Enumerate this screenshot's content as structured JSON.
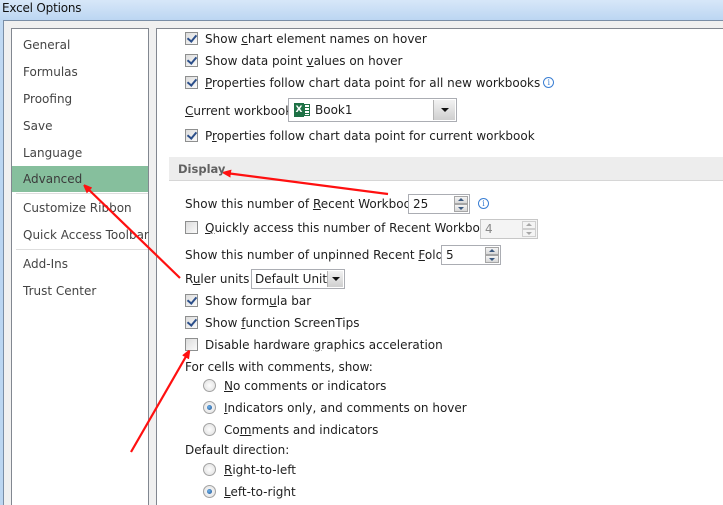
{
  "window": {
    "title": "Excel Options"
  },
  "sidebar": {
    "items": [
      {
        "label": "General"
      },
      {
        "label": "Formulas"
      },
      {
        "label": "Proofing"
      },
      {
        "label": "Save"
      },
      {
        "label": "Language"
      },
      {
        "label": "Advanced",
        "active": true
      },
      {
        "label": "Customize Ribbon"
      },
      {
        "label": "Quick Access Toolbar"
      },
      {
        "label": "Add-Ins"
      },
      {
        "label": "Trust Center"
      }
    ]
  },
  "chart_section": {
    "show_element_names": {
      "label_pre": "Show ",
      "label_u": "c",
      "label_post": "hart element names on hover",
      "checked": true
    },
    "show_data_values": {
      "label_pre": "Show data point ",
      "label_u": "v",
      "label_post": "alues on hover",
      "checked": true
    },
    "props_all_new": {
      "label_pre": "",
      "label_u": "P",
      "label_post": "roperties follow chart data point for all new workbooks",
      "checked": true
    },
    "current_workbook": {
      "label_u": "C",
      "label_post": "urrent workbook:",
      "value": "Book1"
    },
    "props_current": {
      "label_pre": "P",
      "label_u": "r",
      "label_post": "operties follow chart data point for current workbook",
      "checked": true
    }
  },
  "display": {
    "header": "Display",
    "recent_workbooks": {
      "label_pre": "Show this number of ",
      "label_u": "R",
      "label_post": "ecent Workbooks:",
      "value": "25"
    },
    "quick_access": {
      "label_u": "Q",
      "label_post": "uickly access this number of Recent Workbooks:",
      "value": "4",
      "checked": false
    },
    "recent_folders": {
      "label_pre": "Show this number of unpinned Recent ",
      "label_u": "F",
      "label_post": "olders:",
      "value": "5"
    },
    "ruler_units": {
      "label_pre": "R",
      "label_u": "u",
      "label_post": "ler units",
      "value": "Default Units"
    },
    "formula_bar": {
      "label_pre": "Show form",
      "label_u": "u",
      "label_post": "la bar",
      "checked": true
    },
    "function_tips": {
      "label_pre": "Show ",
      "label_u": "f",
      "label_post": "unction ScreenTips",
      "checked": true
    },
    "disable_hw": {
      "label_pre": "Disable hardware ",
      "label_u": "g",
      "label_post": "raphics acceleration",
      "checked": false
    },
    "comments": {
      "label": "For cells with comments, show:",
      "options": [
        {
          "label_pre": "",
          "label_u": "N",
          "label_post": "o comments or indicators",
          "selected": false
        },
        {
          "label_pre": "",
          "label_u": "I",
          "label_post": "ndicators only, and comments on hover",
          "selected": true
        },
        {
          "label_pre": "Co",
          "label_u": "m",
          "label_post": "ments and indicators",
          "selected": false
        }
      ]
    },
    "direction": {
      "label": "Default direction:",
      "options": [
        {
          "label_pre": "",
          "label_u": "R",
          "label_post": "ight-to-left",
          "selected": false
        },
        {
          "label_pre": "",
          "label_u": "L",
          "label_post": "eft-to-right",
          "selected": true
        }
      ]
    }
  },
  "info_glyph": "i",
  "excel_glyph": "X",
  "annotation_color": "#ff1010"
}
